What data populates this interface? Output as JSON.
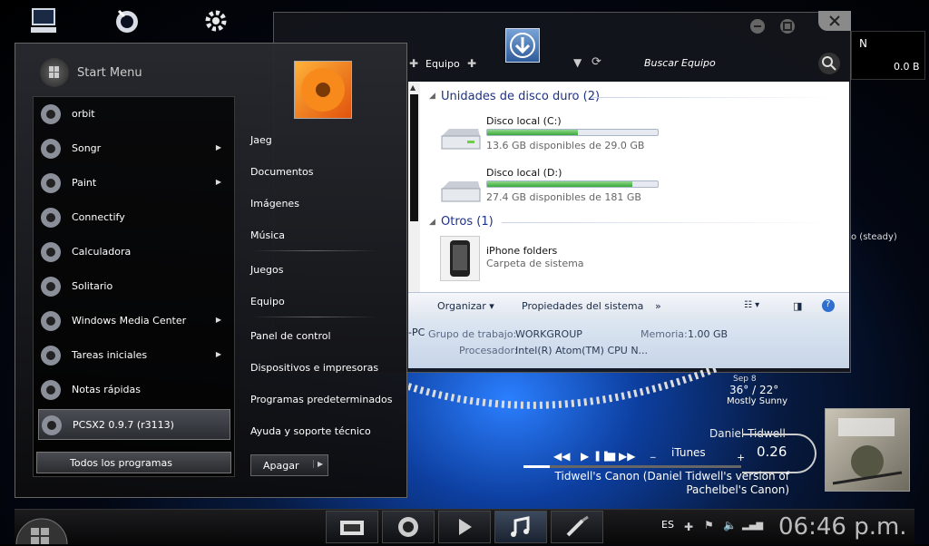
{
  "desktop": {
    "icons": [
      "equipo-icon",
      "firefox-icon",
      "utilities-icon"
    ]
  },
  "start_menu": {
    "title": "Start Menu",
    "programs": [
      {
        "label": "orbit",
        "icon": "orbit-icon",
        "submenu": false
      },
      {
        "label": "Songr",
        "icon": "songr-icon",
        "submenu": true
      },
      {
        "label": "Paint",
        "icon": "paint-icon",
        "submenu": true
      },
      {
        "label": "Connectify",
        "icon": "connectify-icon",
        "submenu": false
      },
      {
        "label": "Calculadora",
        "icon": "calculator-icon",
        "submenu": false
      },
      {
        "label": "Solitario",
        "icon": "solitaire-icon",
        "submenu": false
      },
      {
        "label": "Windows Media Center",
        "icon": "media-center-icon",
        "submenu": true
      },
      {
        "label": "Tareas iniciales",
        "icon": "getting-started-icon",
        "submenu": true
      },
      {
        "label": "Notas rápidas",
        "icon": "sticky-notes-icon",
        "submenu": false
      },
      {
        "label": "PCSX2 0.9.7 (r3113)",
        "icon": "pcsx2-icon",
        "submenu": false
      }
    ],
    "all_programs": "Todos los programas",
    "right": {
      "user": "Jaeg",
      "documents": "Documentos",
      "images": "Imágenes",
      "music": "Música",
      "games": "Juegos",
      "computer": "Equipo",
      "control_panel": "Panel de control",
      "devices": "Dispositivos e impresoras",
      "default_programs": "Programas predeterminados",
      "help": "Ayuda y soporte técnico"
    },
    "shutdown": "Apagar"
  },
  "explorer": {
    "breadcrumb": "Equipo",
    "search_placeholder": "Buscar Equipo",
    "hard_drives_header": "Unidades de disco duro (2)",
    "drives": [
      {
        "name": "Disco local (C:)",
        "info": "13.6 GB disponibles de 29.0 GB",
        "used_fraction": 0.53
      },
      {
        "name": "Disco local (D:)",
        "info": "27.4 GB disponibles de 181 GB",
        "used_fraction": 0.85
      }
    ],
    "others_header": "Otros (1)",
    "others": [
      {
        "name": "iPhone folders",
        "sub": "Carpeta de sistema"
      }
    ],
    "command_bar": {
      "organize": "Organizar",
      "properties": "Propiedades del sistema",
      "more": "»"
    },
    "details": {
      "pc_suffix": "-PC",
      "workgroup_label": "Grupo de trabajo:",
      "workgroup_value": "WORKGROUP",
      "memory_label": "Memoria:",
      "memory_value": "1.00 GB",
      "processor_label": "Procesador:",
      "processor_value": "Intel(R) Atom(TM) CPU N..."
    }
  },
  "net_widget": {
    "letter": "N",
    "value": "0.0 B"
  },
  "partial_text": "o (steady)",
  "weather": {
    "date": "Sep 8",
    "temp": "36° / 22°",
    "condition": "Mostly Sunny"
  },
  "media": {
    "artist": "Daniel Tidwell",
    "time": "0.26",
    "player": "iTunes",
    "track": "Tidwell's Canon (Daniel Tidwell's version of Pachelbel's Canon)",
    "progress": 0.12
  },
  "tray": {
    "lang": "ES",
    "clock": "06:46 p.m."
  },
  "colors": {
    "accent": "#1e3287",
    "bar_green": "#3aa83a"
  }
}
